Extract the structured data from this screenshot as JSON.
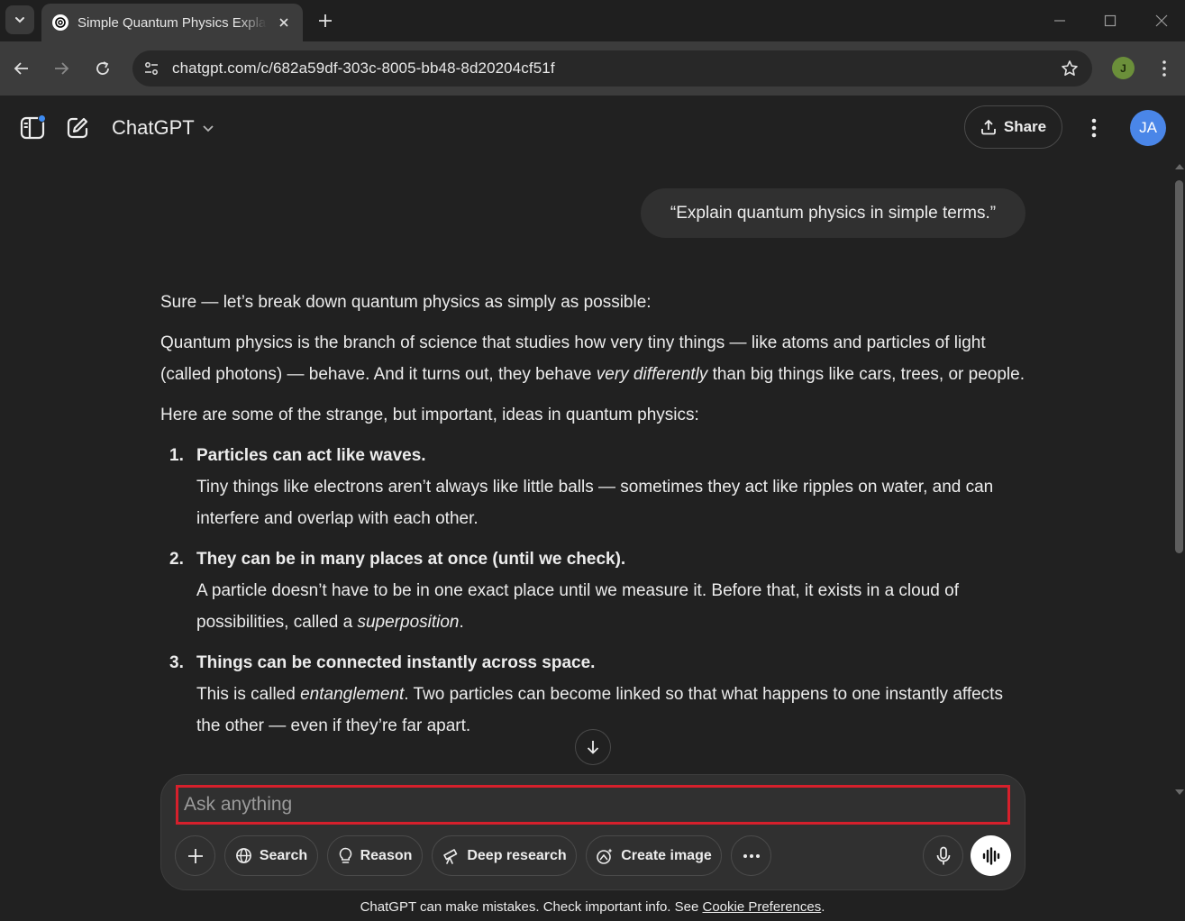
{
  "browser": {
    "tab_title": "Simple Quantum Physics Explained",
    "url": "chatgpt.com/c/682a59df-303c-8005-bb48-8d20204cf51f",
    "profile_initial": "J"
  },
  "header": {
    "model_name": "ChatGPT",
    "share_label": "Share",
    "avatar_initials": "JA"
  },
  "conversation": {
    "user_message": "“Explain quantum physics in simple terms.”",
    "reply": {
      "intro": "Sure — let’s break down quantum physics as simply as possible:",
      "para1_a": "Quantum physics is the branch of science that studies how very tiny things — like atoms and particles of light (called photons) — behave. And it turns out, they behave ",
      "para1_em": "very differently",
      "para1_b": " than big things like cars, trees, or people.",
      "para2": "Here are some of the strange, but important, ideas in quantum physics:",
      "items": [
        {
          "num": "1.",
          "title": "Particles can act like waves.",
          "body_a": "Tiny things like electrons aren’t always like little balls — sometimes they act like ripples on water, and can interfere and overlap with each other.",
          "body_em": "",
          "body_b": ""
        },
        {
          "num": "2.",
          "title": "They can be in many places at once (until we check).",
          "body_a": "A particle doesn’t have to be in one exact place until we measure it. Before that, it exists in a cloud of possibilities, called a ",
          "body_em": "superposition",
          "body_b": "."
        },
        {
          "num": "3.",
          "title": "Things can be connected instantly across space.",
          "body_a": "This is called ",
          "body_em": "entanglement",
          "body_b": ". Two particles can become linked so that what happens to one instantly affects the other — even if they’re far apart."
        }
      ]
    }
  },
  "composer": {
    "placeholder": "Ask anything",
    "search_label": "Search",
    "reason_label": "Reason",
    "deep_research_label": "Deep research",
    "create_image_label": "Create image"
  },
  "footer": {
    "note": "ChatGPT can make mistakes. Check important info. See ",
    "link": "Cookie Preferences",
    "end": "."
  }
}
